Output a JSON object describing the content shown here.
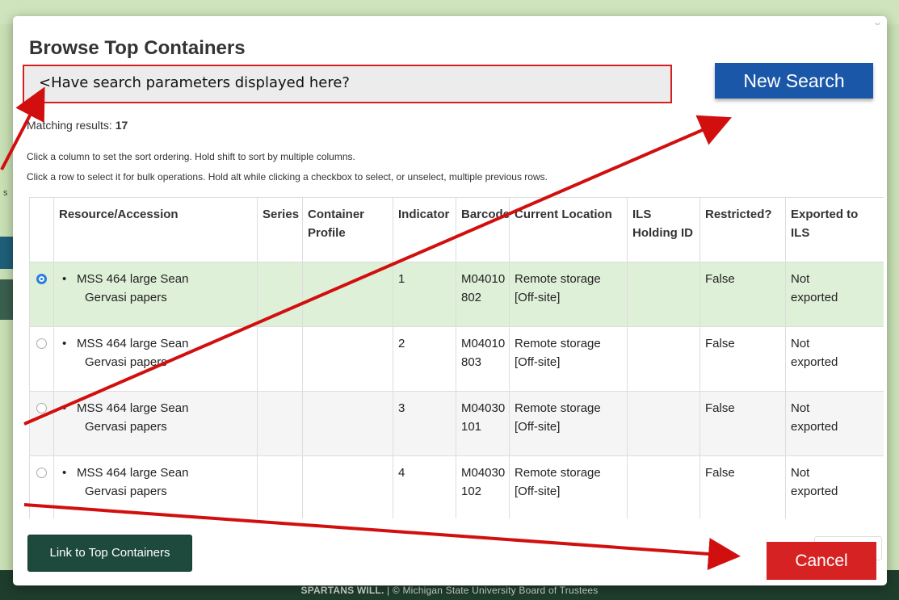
{
  "modal": {
    "title": "Browse Top Containers",
    "close_glyph": "˘",
    "search_params_note": "<Have search parameters displayed here?",
    "new_search_label": "New Search",
    "matching_label": "Matching results: ",
    "matching_count": "17",
    "help_sort": "Click a column to set the sort ordering. Hold shift to sort by multiple columns.",
    "help_select": "Click a row to select it for bulk operations. Hold alt while clicking a checkbox to select, or unselect, multiple previous rows.",
    "link_button_label": "Link to Top Containers",
    "cancel_label": "Cancel"
  },
  "table": {
    "headers": [
      "",
      "Resource/Accession",
      "Series",
      "Container Profile",
      "Indicator",
      "Barcode",
      "Current Location",
      "ILS Holding ID",
      "Restricted?",
      "Exported to ILS"
    ],
    "rows": [
      {
        "selected": true,
        "res1": "MSS 464 large Sean",
        "res2": "Gervasi papers",
        "series": "",
        "profile": "",
        "indicator": "1",
        "barcode1": "M04010",
        "barcode2": "802",
        "loc1": "Remote storage",
        "loc2": "[Off-site]",
        "ils": "",
        "restricted": "False",
        "exp1": "Not",
        "exp2": "exported"
      },
      {
        "selected": false,
        "res1": "MSS 464 large Sean",
        "res2": "Gervasi papers",
        "series": "",
        "profile": "",
        "indicator": "2",
        "barcode1": "M04010",
        "barcode2": "803",
        "loc1": "Remote storage",
        "loc2": "[Off-site]",
        "ils": "",
        "restricted": "False",
        "exp1": "Not",
        "exp2": "exported"
      },
      {
        "selected": false,
        "res1": "MSS 464 large Sean",
        "res2": "Gervasi papers",
        "series": "",
        "profile": "",
        "indicator": "3",
        "barcode1": "M04030",
        "barcode2": "101",
        "loc1": "Remote storage",
        "loc2": "[Off-site]",
        "ils": "",
        "restricted": "False",
        "exp1": "Not",
        "exp2": "exported"
      },
      {
        "selected": false,
        "res1": "MSS 464 large Sean",
        "res2": "Gervasi papers",
        "series": "",
        "profile": "",
        "indicator": "4",
        "barcode1": "M04030",
        "barcode2": "102",
        "loc1": "Remote storage",
        "loc2": "[Off-site]",
        "ils": "",
        "restricted": "False",
        "exp1": "Not",
        "exp2": "exported"
      }
    ]
  },
  "footer": {
    "brand": "SPARTANS WILL.",
    "copyright": "| © Michigan State University Board of Trustees"
  },
  "background": {
    "left_mark": "s"
  },
  "colors": {
    "accent_blue": "#1a57a8",
    "annotation_red": "#d32121",
    "primary_dark_green": "#1d4a3c",
    "selected_row": "#dff0d8"
  }
}
